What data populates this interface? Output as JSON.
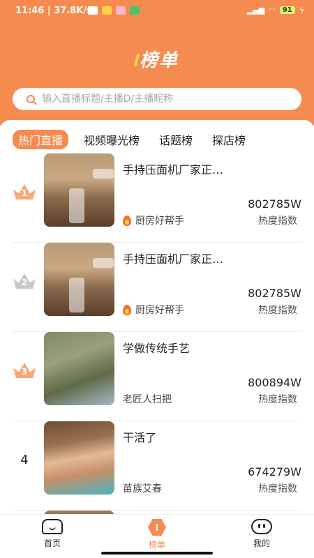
{
  "status_bar": {
    "time": "11:46",
    "network_speed": "37.8K/s",
    "battery": "91",
    "icons": [
      "alarm-icon",
      "app-notification-icon",
      "signal-icon",
      "wifi-icon",
      "battery-icon",
      "charging-icon"
    ]
  },
  "header": {
    "title": "榜单",
    "search_placeholder": "输入直播标题/主播D/主播昵称"
  },
  "tabs": [
    {
      "label": "热门直播",
      "active": true
    },
    {
      "label": "视频曝光榜",
      "active": false
    },
    {
      "label": "话题榜",
      "active": false
    },
    {
      "label": "探店榜",
      "active": false
    }
  ],
  "list": [
    {
      "rank": "1",
      "title": "手持压面机厂家正…",
      "host": "厨房好帮手",
      "has_flame": true,
      "value": "802785W",
      "value_label": "热度指数"
    },
    {
      "rank": "2",
      "title": "手持压面机厂家正…",
      "host": "厨房好帮手",
      "has_flame": true,
      "value": "802785W",
      "value_label": "热度指数"
    },
    {
      "rank": "3",
      "title": "学做传统手艺",
      "host": "老匠人扫把",
      "has_flame": false,
      "value": "800894W",
      "value_label": "热度指数"
    },
    {
      "rank": "4",
      "title": "干活了",
      "host": "苗族艾春",
      "has_flame": false,
      "value": "674279W",
      "value_label": "热度指数"
    }
  ],
  "bottom_nav": [
    {
      "label": "首页",
      "icon": "home-icon",
      "active": false
    },
    {
      "label": "榜单",
      "icon": "ranking-icon",
      "active": true
    },
    {
      "label": "我的",
      "icon": "profile-icon",
      "active": false
    }
  ],
  "colors": {
    "accent": "#f58b4f",
    "gold_crown": "#f9a97e",
    "silver_crown": "#c8c8c8",
    "bronze_crown": "#f8a77a"
  }
}
